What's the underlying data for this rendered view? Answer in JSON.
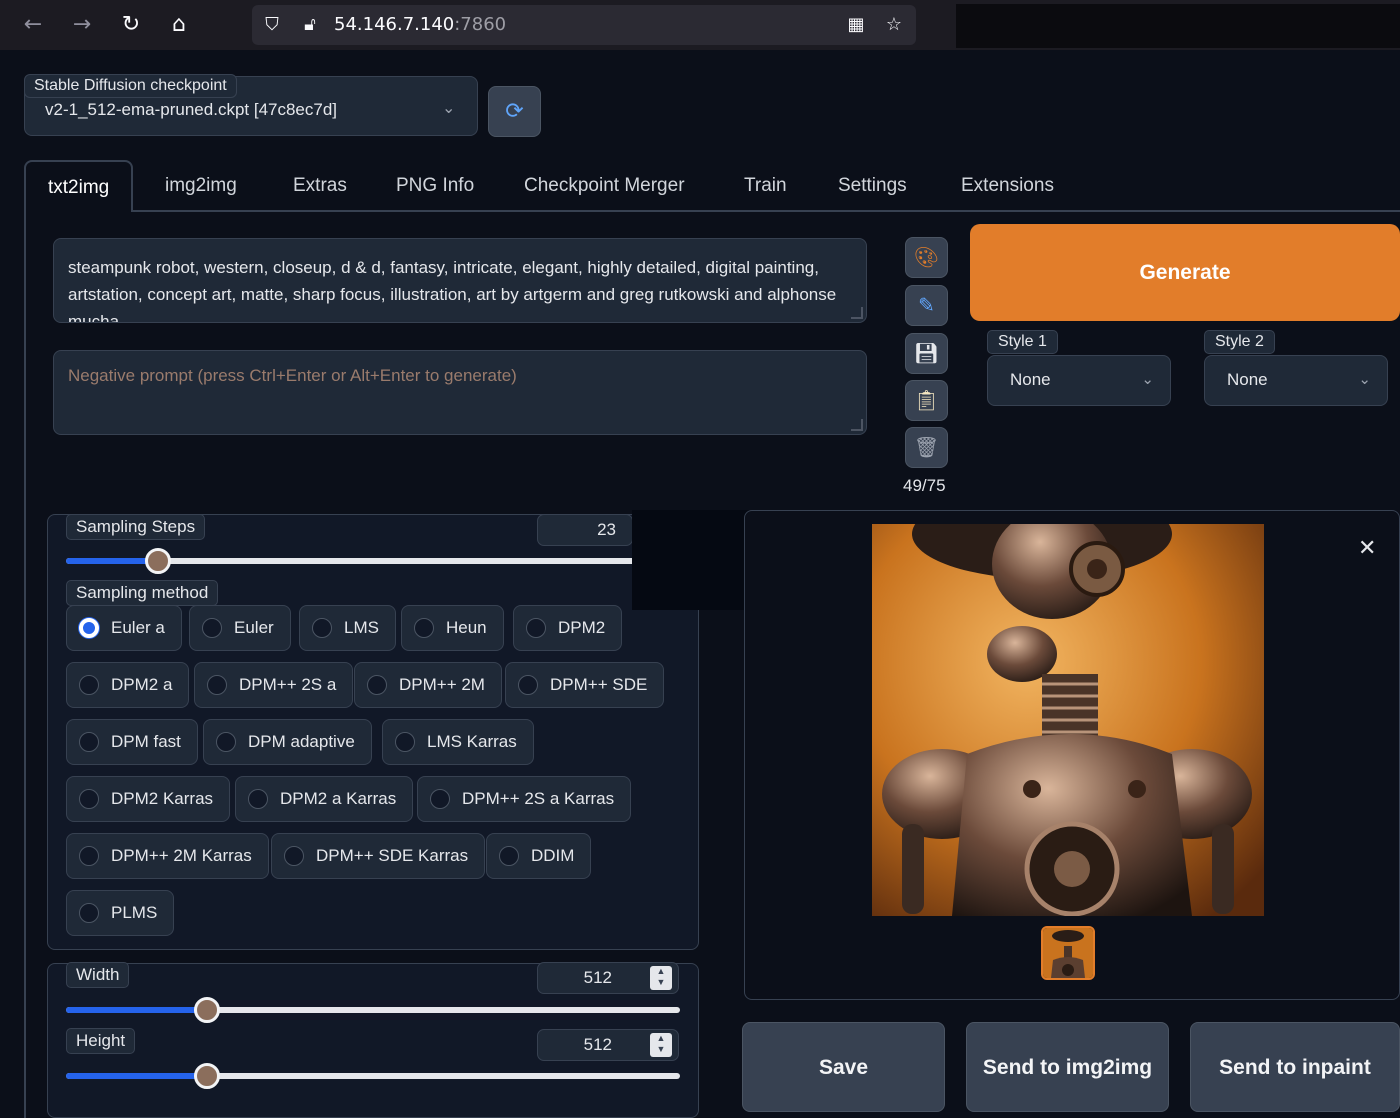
{
  "browser": {
    "url_host": "54.146.7.140",
    "url_port": ":7860"
  },
  "checkpoint": {
    "label": "Stable Diffusion checkpoint",
    "value": "v2-1_512-ema-pruned.ckpt [47c8ec7d]"
  },
  "tabs": [
    {
      "label": "txt2img",
      "active": true
    },
    {
      "label": "img2img"
    },
    {
      "label": "Extras"
    },
    {
      "label": "PNG Info"
    },
    {
      "label": "Checkpoint Merger"
    },
    {
      "label": "Train"
    },
    {
      "label": "Settings"
    },
    {
      "label": "Extensions"
    }
  ],
  "prompt": {
    "value": "steampunk robot, western, closeup, d & d, fantasy, intricate, elegant, highly detailed, digital painting, artstation, concept art, matte, sharp focus, illustration, art by artgerm and greg rutkowski and alphonse mucha",
    "negative_placeholder": "Negative prompt (press Ctrl+Enter or Alt+Enter to generate)",
    "token_count": "49/75"
  },
  "generate": {
    "label": "Generate",
    "color": "#e27d2a"
  },
  "styles": {
    "style1_label": "Style 1",
    "style1_value": "None",
    "style2_label": "Style 2",
    "style2_value": "None"
  },
  "sampling": {
    "steps_label": "Sampling Steps",
    "steps_value": "23",
    "steps_fraction": 0.15,
    "method_label": "Sampling method",
    "methods": [
      "Euler a",
      "Euler",
      "LMS",
      "Heun",
      "DPM2",
      "DPM2 a",
      "DPM++ 2S a",
      "DPM++ 2M",
      "DPM++ SDE",
      "DPM fast",
      "DPM adaptive",
      "LMS Karras",
      "DPM2 Karras",
      "DPM2 a Karras",
      "DPM++ 2S a Karras",
      "DPM++ 2M Karras",
      "DPM++ SDE Karras",
      "DDIM",
      "PLMS"
    ],
    "selected": "Euler a"
  },
  "size": {
    "width_label": "Width",
    "width_value": "512",
    "width_fraction": 0.23,
    "height_label": "Height",
    "height_value": "512",
    "height_fraction": 0.23
  },
  "actions": {
    "save": "Save",
    "send_img2img": "Send to img2img",
    "send_inpaint": "Send to inpaint"
  }
}
